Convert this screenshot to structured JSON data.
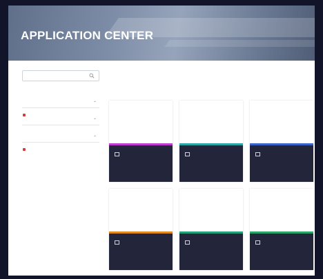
{
  "banner": {
    "title": "APPLICATION CENTER",
    "subtitle": "",
    "link": ""
  },
  "search": {
    "placeholder": ""
  },
  "sidebar": {
    "groups": [
      {
        "title": "",
        "items": [
          {
            "label": "",
            "marked": false
          },
          {
            "label": "",
            "marked": false
          },
          {
            "label": "",
            "marked": false
          },
          {
            "label": "",
            "marked": false
          },
          {
            "label": "",
            "marked": false
          },
          {
            "label": "",
            "marked": false
          },
          {
            "label": "",
            "marked": true
          }
        ]
      },
      {
        "title": "",
        "items": [
          {
            "label": "",
            "marked": false
          },
          {
            "label": "",
            "marked": false
          },
          {
            "label": "",
            "marked": false
          },
          {
            "label": "",
            "marked": false
          },
          {
            "label": "",
            "marked": false
          }
        ]
      },
      {
        "title": "",
        "items": [
          {
            "label": "",
            "marked": true
          },
          {
            "label": "",
            "marked": false
          },
          {
            "label": "",
            "marked": false
          }
        ]
      }
    ]
  },
  "cards": [
    {
      "description": "",
      "title": "",
      "meta": "",
      "accent": "#c23bd1"
    },
    {
      "description": "",
      "title": "",
      "meta": "",
      "accent": "#2aa6a6"
    },
    {
      "description": "",
      "title": "",
      "meta": "",
      "accent": "#3a63c8"
    },
    {
      "description": "",
      "title": "",
      "meta": "",
      "accent": "#e08a1e"
    },
    {
      "description": "",
      "title": "",
      "meta": "",
      "accent": "#22a27a"
    },
    {
      "description": "",
      "title": "",
      "meta": "",
      "accent": "#2aa66a"
    }
  ]
}
